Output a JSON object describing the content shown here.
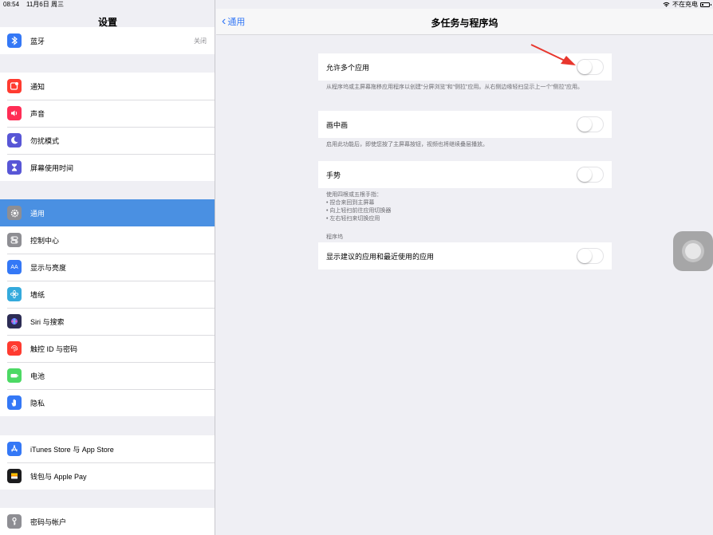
{
  "status": {
    "time": "08:54",
    "date": "11月6日 周三",
    "charging": "不在充电",
    "icons": [
      "wifi-icon",
      "battery-icon"
    ]
  },
  "sidebar": {
    "title": "设置",
    "groups": [
      {
        "items": [
          {
            "label": "蓝牙",
            "value": "关闭",
            "icon": "bluetooth-icon",
            "color": "#3478f6"
          }
        ]
      },
      {
        "items": [
          {
            "label": "通知",
            "icon": "notification-icon",
            "color": "#ff3b30"
          },
          {
            "label": "声音",
            "icon": "sound-icon",
            "color": "#ff2d55"
          },
          {
            "label": "勿扰模式",
            "icon": "moon-icon",
            "color": "#5856d6"
          },
          {
            "label": "屏幕使用时间",
            "icon": "hourglass-icon",
            "color": "#5856d6"
          }
        ]
      },
      {
        "items": [
          {
            "label": "通用",
            "icon": "gear-icon",
            "color": "#8e8e93",
            "active": true
          },
          {
            "label": "控制中心",
            "icon": "toggles-icon",
            "color": "#8e8e93"
          },
          {
            "label": "显示与亮度",
            "icon": "display-icon",
            "color": "#3478f6"
          },
          {
            "label": "墙纸",
            "icon": "wallpaper-icon",
            "color": "#34aadc"
          },
          {
            "label": "Siri 与搜索",
            "icon": "siri-icon",
            "color": "#2c2c54"
          },
          {
            "label": "触控 ID 与密码",
            "icon": "fingerprint-icon",
            "color": "#ff3b30"
          },
          {
            "label": "电池",
            "icon": "battery-icon",
            "color": "#4cd964"
          },
          {
            "label": "隐私",
            "icon": "hand-icon",
            "color": "#3478f6"
          }
        ]
      },
      {
        "items": [
          {
            "label": "iTunes Store 与 App Store",
            "icon": "app-store-icon",
            "color": "#3478f6"
          },
          {
            "label": "钱包与 Apple Pay",
            "icon": "wallet-icon",
            "color": "#1c1c1e"
          }
        ]
      },
      {
        "items": [
          {
            "label": "密码与帐户",
            "icon": "key-icon",
            "color": "#8e8e93"
          }
        ]
      }
    ]
  },
  "nav": {
    "back_label": "通用",
    "title": "多任务与程序坞"
  },
  "settings": {
    "multi_app": {
      "label": "允许多个应用",
      "on": false
    },
    "multi_app_footer": "从程序坞或主屏幕拖移应用程序以创建“分屏浏览”和“侧拉”应用。从右侧边缘轻扫显示上一个“侧拉”应用。",
    "pip": {
      "label": "画中画",
      "on": false
    },
    "pip_footer": "启用此功能后，即使您按了主屏幕按钮，视频也将继续叠层播放。",
    "gestures": {
      "label": "手势",
      "on": false
    },
    "gestures_footer": [
      "使用四根或五根手指：",
      "• 捏合来回到主屏幕",
      "• 向上轻扫前往应用切换器",
      "• 左右轻扫来切换应用"
    ],
    "dock_header": "程序坞",
    "dock": {
      "label": "显示建议的应用和最近使用的应用",
      "on": false
    }
  },
  "colors": {
    "accent": "#3478f6",
    "selected_row": "#4a90e2",
    "arrow": "#e8362d"
  }
}
